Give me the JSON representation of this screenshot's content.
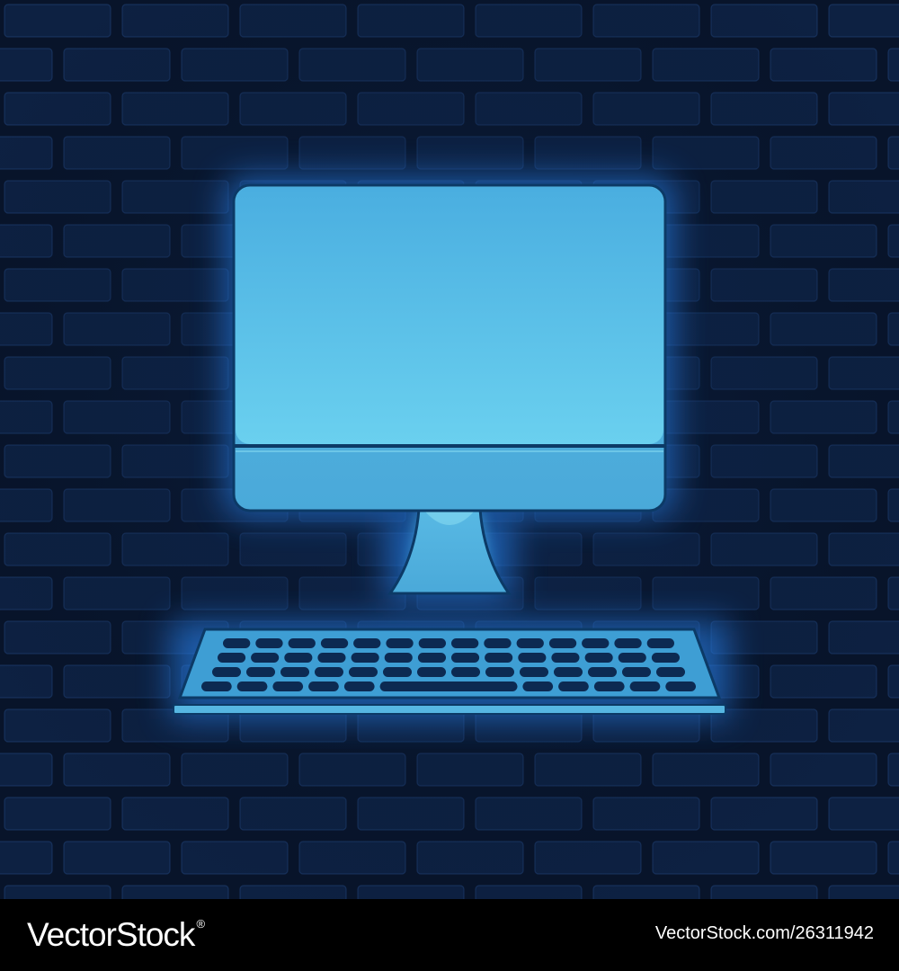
{
  "illustration": {
    "subject": "computer-monitor-with-keyboard",
    "colors": {
      "wall_background": "#08142a",
      "brick_fill": "#0d2142",
      "brick_highlight": "#1f3f73",
      "glow": "#2c8cff",
      "screen": "#52b8df",
      "screen_light": "#7ad2ee",
      "outline": "#0c3a66",
      "key": "#0c2a52"
    }
  },
  "footer": {
    "brand": "VectorStock",
    "brand_mark": "®",
    "image_id": "VectorStock.com/26311942",
    "background": "#000000",
    "text_color": "#ffffff"
  }
}
